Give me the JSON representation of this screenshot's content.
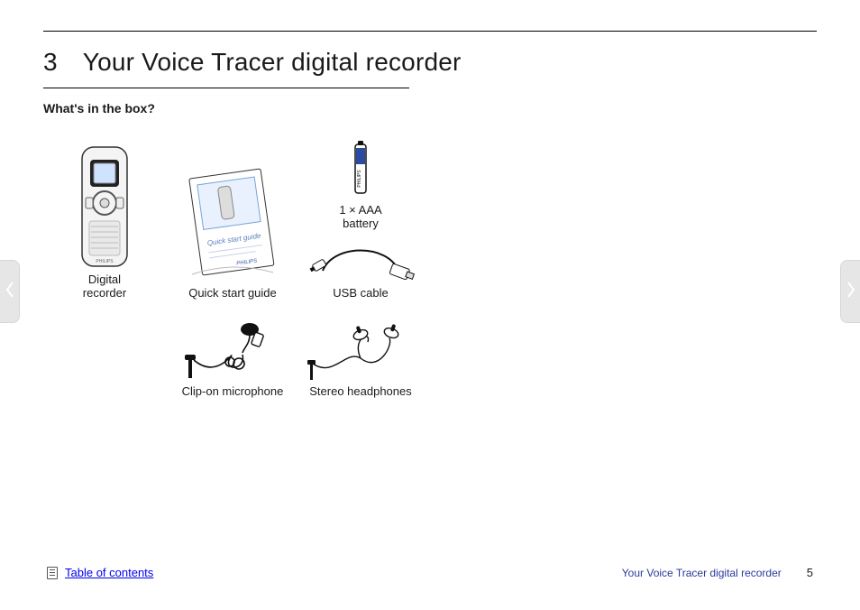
{
  "section": {
    "number": "3",
    "title": "Your Voice Tracer digital recorder"
  },
  "subheading": "What's in the box?",
  "items": {
    "recorder": {
      "label": "Digital\nrecorder"
    },
    "guide": {
      "label": "Quick start guide"
    },
    "battery": {
      "label": "1 × AAA\nbattery"
    },
    "usb": {
      "label": "USB cable"
    },
    "mic": {
      "label": "Clip-on microphone"
    },
    "headphones": {
      "label": "Stereo headphones"
    }
  },
  "footer": {
    "toc": "Table of contents",
    "chapter": "Your Voice Tracer digital recorder",
    "page": "5"
  }
}
